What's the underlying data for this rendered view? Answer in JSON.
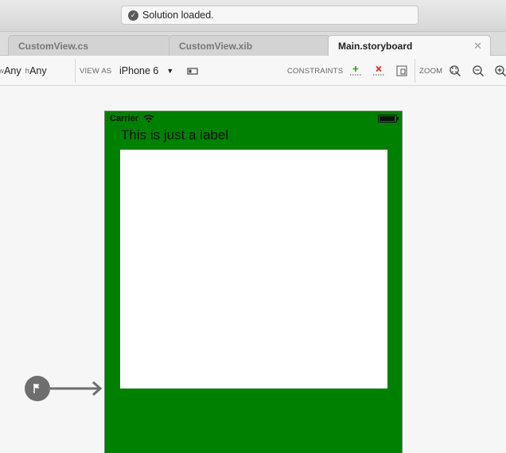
{
  "status": {
    "text": "Solution loaded."
  },
  "tabs": [
    {
      "label": "CustomView.cs",
      "active": false
    },
    {
      "label": "CustomView.xib",
      "active": false
    },
    {
      "label": "Main.storyboard",
      "active": true
    }
  ],
  "toolbar": {
    "size_class_w_prefix": "w",
    "size_class_w": "Any",
    "size_class_h_prefix": "h",
    "size_class_h": "Any",
    "view_as_label": "VIEW AS",
    "device": "iPhone 6",
    "constraints_label": "CONSTRAINTS",
    "zoom_label": "ZOOM"
  },
  "device_screen": {
    "carrier": "Carrier",
    "label_text": "This is just a label",
    "background_color": "#008000",
    "inner_view_color": "#ffffff"
  }
}
